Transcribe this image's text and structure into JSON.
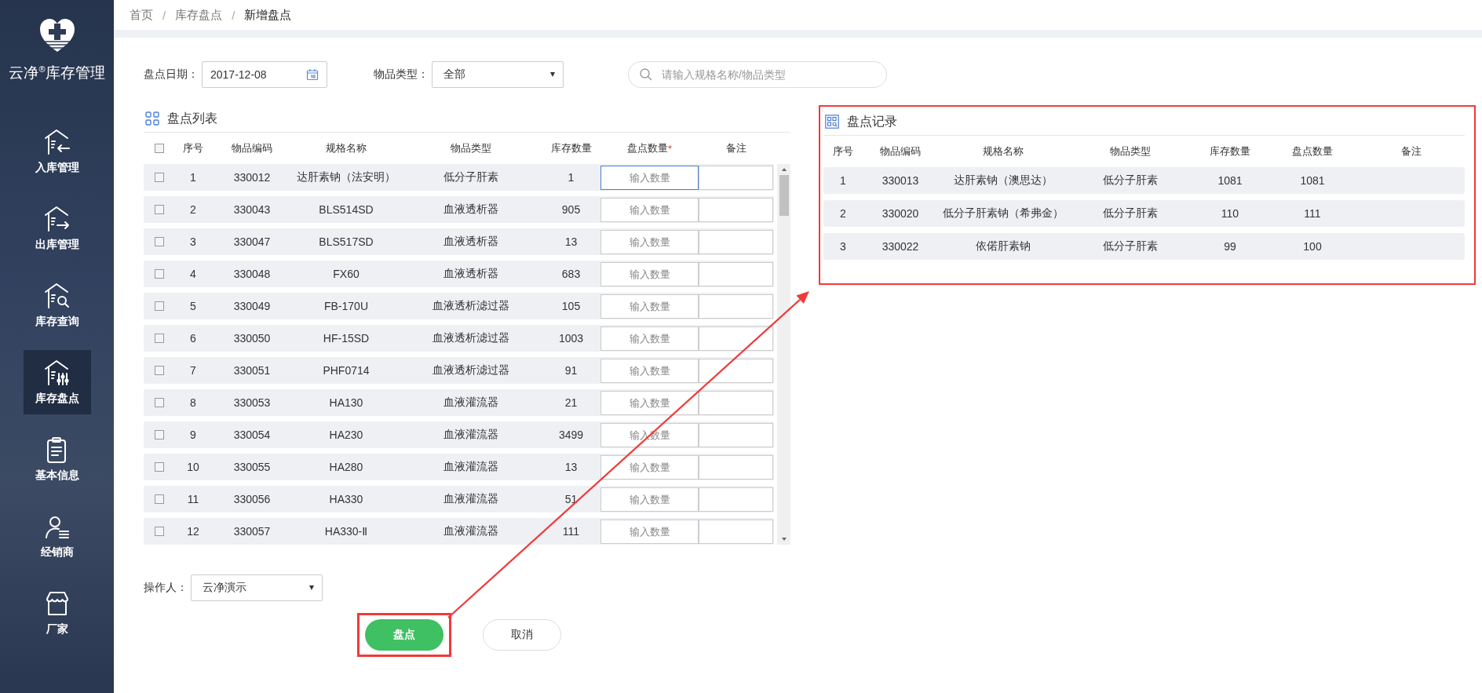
{
  "sidebar": {
    "logo_text": "云净$^{®}$库存管理",
    "items": [
      {
        "label": "入库管理",
        "selected": false
      },
      {
        "label": "出库管理",
        "selected": false
      },
      {
        "label": "库存查询",
        "selected": false
      },
      {
        "label": "库存盘点",
        "selected": true
      },
      {
        "label": "基本信息",
        "selected": false
      },
      {
        "label": "经销商",
        "selected": false
      },
      {
        "label": "厂家",
        "selected": false
      }
    ]
  },
  "breadcrumb": [
    {
      "label": "首页",
      "current": false
    },
    {
      "separator": "/",
      "label": "库存盘点",
      "current": false
    },
    {
      "separator": "/",
      "label": "新增盘点",
      "current": true
    }
  ],
  "filters": {
    "date": {
      "label": "盘点日期：",
      "value": "2017-12-08"
    },
    "type": {
      "label": "物品类型：",
      "value": "全部"
    },
    "search": {
      "placeholder": "请输入规格名称/物品类型"
    }
  },
  "list_panel": {
    "title": "盘点列表",
    "select_all_checked": false,
    "columns": [
      {
        "label": "序号"
      },
      {
        "label": "物品编码"
      },
      {
        "label": "规格名称"
      },
      {
        "label": "物品类型"
      },
      {
        "label": "库存数量"
      },
      {
        "label": "盘点数量",
        "required_mark": "*"
      },
      {
        "label": "备注"
      }
    ],
    "rows": [
      {
        "checked": false,
        "seq": "1",
        "code": "330012",
        "spec": "达肝素钠（法安明）",
        "type": "低分子肝素",
        "stock": "1",
        "count_placeholder": "输入数量",
        "focused": true
      },
      {
        "checked": false,
        "seq": "2",
        "code": "330043",
        "spec": "BLS514SD",
        "type": "血液透析器",
        "stock": "905",
        "count_placeholder": "输入数量",
        "focused": false
      },
      {
        "checked": false,
        "seq": "3",
        "code": "330047",
        "spec": "BLS517SD",
        "type": "血液透析器",
        "stock": "13",
        "count_placeholder": "输入数量",
        "focused": false
      },
      {
        "checked": false,
        "seq": "4",
        "code": "330048",
        "spec": "FX60",
        "type": "血液透析器",
        "stock": "683",
        "count_placeholder": "输入数量",
        "focused": false
      },
      {
        "checked": false,
        "seq": "5",
        "code": "330049",
        "spec": "FB-170U",
        "type": "血液透析滤过器",
        "stock": "105",
        "count_placeholder": "输入数量",
        "focused": false
      },
      {
        "checked": false,
        "seq": "6",
        "code": "330050",
        "spec": "HF-15SD",
        "type": "血液透析滤过器",
        "stock": "1003",
        "count_placeholder": "输入数量",
        "focused": false
      },
      {
        "checked": false,
        "seq": "7",
        "code": "330051",
        "spec": "PHF0714",
        "type": "血液透析滤过器",
        "stock": "91",
        "count_placeholder": "输入数量",
        "focused": false
      },
      {
        "checked": false,
        "seq": "8",
        "code": "330053",
        "spec": "HA130",
        "type": "血液灌流器",
        "stock": "21",
        "count_placeholder": "输入数量",
        "focused": false
      },
      {
        "checked": false,
        "seq": "9",
        "code": "330054",
        "spec": "HA230",
        "type": "血液灌流器",
        "stock": "3499",
        "count_placeholder": "输入数量",
        "focused": false
      },
      {
        "checked": false,
        "seq": "10",
        "code": "330055",
        "spec": "HA280",
        "type": "血液灌流器",
        "stock": "13",
        "count_placeholder": "输入数量",
        "focused": false
      },
      {
        "checked": false,
        "seq": "11",
        "code": "330056",
        "spec": "HA330",
        "type": "血液灌流器",
        "stock": "51",
        "count_placeholder": "输入数量",
        "focused": false
      },
      {
        "checked": false,
        "seq": "12",
        "code": "330057",
        "spec": "HA330-Ⅱ",
        "type": "血液灌流器",
        "stock": "111",
        "count_placeholder": "输入数量",
        "focused": false
      }
    ]
  },
  "record_panel": {
    "title": "盘点记录",
    "highlighted": true,
    "columns": [
      {
        "label": "序号"
      },
      {
        "label": "物品编码"
      },
      {
        "label": "规格名称"
      },
      {
        "label": "物品类型"
      },
      {
        "label": "库存数量"
      },
      {
        "label": "盘点数量"
      },
      {
        "label": "备注"
      }
    ],
    "rows": [
      {
        "seq": "1",
        "code": "330013",
        "spec": "达肝素钠（澳思达）",
        "type": "低分子肝素",
        "stock": "1081",
        "count": "1081"
      },
      {
        "seq": "2",
        "code": "330020",
        "spec": "低分子肝素钠（希弗金）",
        "type": "低分子肝素",
        "stock": "110",
        "count": "111"
      },
      {
        "seq": "3",
        "code": "330022",
        "spec": "依偌肝素钠",
        "type": "低分子肝素",
        "stock": "99",
        "count": "100"
      }
    ]
  },
  "operator": {
    "label": "操作人：",
    "value": "云净演示"
  },
  "buttons": [
    {
      "label": "盘点",
      "kind": "primary",
      "highlighted": true
    },
    {
      "label": "取消",
      "kind": "secondary",
      "highlighted": false
    }
  ]
}
